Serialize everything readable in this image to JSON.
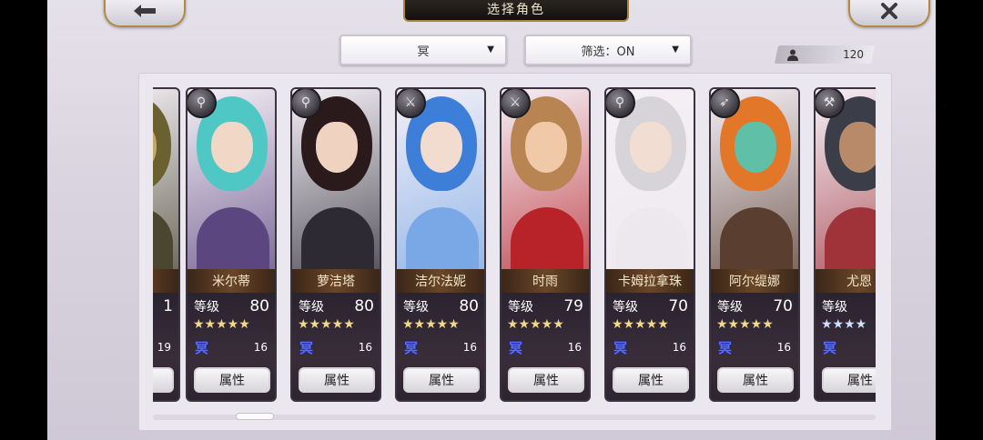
{
  "header": {
    "title": "选择角色",
    "back_icon": "back-arrow-icon",
    "close_icon": "close-x-icon"
  },
  "filters": {
    "element_value": "冥",
    "filter_value": "筛选：ON",
    "caret": "▼"
  },
  "roster_count": "120",
  "attribute_label": "属性",
  "level_label": "等级",
  "cards": [
    {
      "name": "",
      "level": "1",
      "count": "19",
      "stars": "★",
      "star_color": "gold",
      "class": "partial",
      "hair": "#6a6030",
      "skin": "#c7a66a",
      "outfit": "#4a4630"
    },
    {
      "name": "米尔蒂",
      "level": "80",
      "count": "16",
      "stars": "★★★★★",
      "star_color": "gold",
      "class": "staff",
      "hair": "#4fc7c4",
      "skin": "#f1d7c6",
      "outfit": "#5b4680"
    },
    {
      "name": "萝洁塔",
      "level": "80",
      "count": "16",
      "stars": "★★★★★",
      "star_color": "gold",
      "class": "staff",
      "hair": "#2a1a1c",
      "skin": "#efd2bf",
      "outfit": "#2e2a34"
    },
    {
      "name": "洁尔法妮",
      "level": "80",
      "count": "16",
      "stars": "★★★★★",
      "star_color": "gold",
      "class": "sword",
      "hair": "#3d7ed8",
      "skin": "#f2dccf",
      "outfit": "#7aa8e6"
    },
    {
      "name": "时雨",
      "level": "79",
      "count": "16",
      "stars": "★★★★★",
      "star_color": "gold",
      "class": "sword",
      "hair": "#b88552",
      "skin": "#f0c9a8",
      "outfit": "#b8232a"
    },
    {
      "name": "卡姆拉拿珠",
      "level": "70",
      "count": "16",
      "stars": "★★★★★",
      "star_color": "gold",
      "class": "staff",
      "hair": "#d6d4d8",
      "skin": "#f2ddd2",
      "outfit": "#ece8ee"
    },
    {
      "name": "阿尔缇娜",
      "level": "70",
      "count": "16",
      "stars": "★★★★★",
      "star_color": "gold",
      "class": "bow",
      "hair": "#e2772a",
      "skin": "#5fbfa7",
      "outfit": "#5a3e30"
    },
    {
      "name": "尤恩",
      "level": "",
      "count": "",
      "stars": "★★★★",
      "star_color": "blue",
      "class": "axe",
      "hair": "#3b3e48",
      "skin": "#b88a6a",
      "outfit": "#a0323a"
    }
  ]
}
